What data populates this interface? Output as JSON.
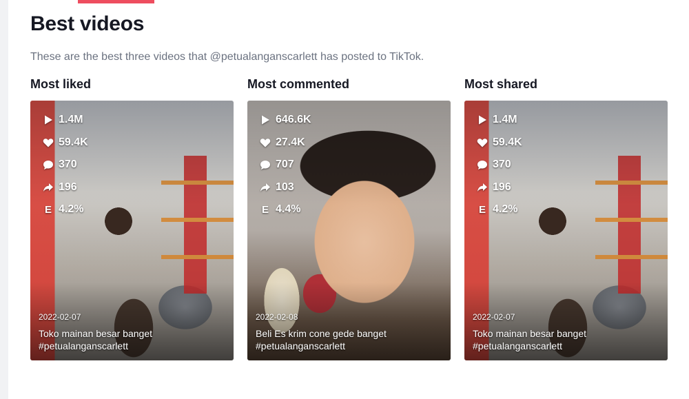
{
  "section": {
    "title": "Best videos",
    "subtitle": "These are the best three videos that @petualanganscarlett has posted to TikTok."
  },
  "columns": [
    {
      "heading": "Most liked",
      "stats": {
        "views": "1.4M",
        "likes": "59.4K",
        "comments": "370",
        "shares": "196",
        "engagement": "4.2%"
      },
      "date": "2022-02-07",
      "caption_line1": "Toko mainan besar banget",
      "caption_line2": "#petualanganscarlett"
    },
    {
      "heading": "Most commented",
      "stats": {
        "views": "646.6K",
        "likes": "27.4K",
        "comments": "707",
        "shares": "103",
        "engagement": "4.4%"
      },
      "date": "2022-02-08",
      "caption_line1": "Beli Es krim cone gede banget",
      "caption_line2": "#petualanganscarlett"
    },
    {
      "heading": "Most shared",
      "stats": {
        "views": "1.4M",
        "likes": "59.4K",
        "comments": "370",
        "shares": "196",
        "engagement": "4.2%"
      },
      "date": "2022-02-07",
      "caption_line1": "Toko mainan besar banget",
      "caption_line2": "#petualanganscarlett"
    }
  ],
  "icons": {
    "views": "play-icon",
    "likes": "heart-icon",
    "comments": "comment-icon",
    "shares": "share-arrow-icon",
    "engagement": "E"
  },
  "colors": {
    "accent": "#ee4d5f",
    "subtitle": "#6b7280",
    "text": "#161823"
  }
}
